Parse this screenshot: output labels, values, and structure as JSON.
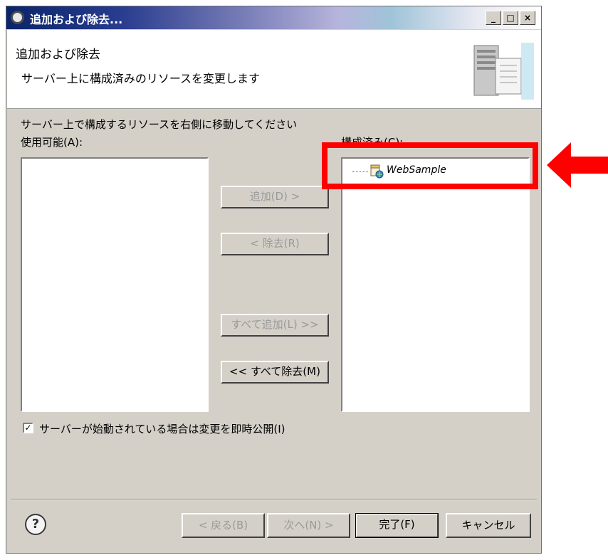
{
  "window": {
    "title": "追加および除去..."
  },
  "title_buttons": {
    "minimize": "_",
    "maximize": "□",
    "close": "×"
  },
  "banner": {
    "title": "追加および除去",
    "description": "サーバー上に構成済みのリソースを変更します"
  },
  "instruction": "サーバー上で構成するリソースを右側に移動してください",
  "available": {
    "label": "使用可能(A):",
    "items": []
  },
  "configured": {
    "label": "構成済み(C):",
    "items": [
      {
        "label": "WebSample",
        "icon": "web-module-icon"
      }
    ]
  },
  "buttons": {
    "add": "追加(D) >",
    "remove": "< 除去(R)",
    "add_all": "すべて追加(L) >>",
    "remove_all": "<< すべて除去(M)"
  },
  "publish_option": {
    "checked": true,
    "label": "サーバーが始動されている場合は変更を即時公開(I)"
  },
  "footer": {
    "back": "< 戻る(B)",
    "next": "次へ(N) >",
    "finish": "完了(F)",
    "cancel": "キャンセル"
  },
  "annotation": {
    "color": "#ff0000"
  }
}
